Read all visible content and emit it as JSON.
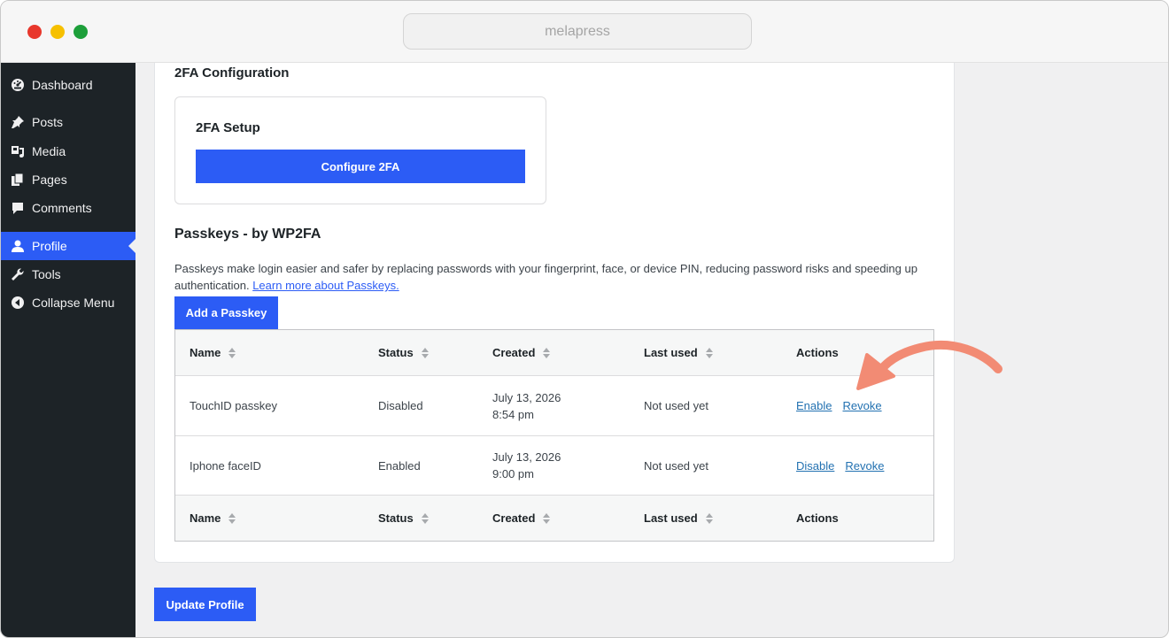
{
  "browser": {
    "url": "melapress"
  },
  "sidebar": {
    "items": [
      {
        "label": "Dashboard",
        "icon": "dashboard-icon"
      },
      {
        "label": "Posts",
        "icon": "pin-icon"
      },
      {
        "label": "Media",
        "icon": "media-icon"
      },
      {
        "label": "Pages",
        "icon": "pages-icon"
      },
      {
        "label": "Comments",
        "icon": "comment-icon"
      },
      {
        "label": "Profile",
        "icon": "user-icon",
        "active": true
      },
      {
        "label": "Tools",
        "icon": "wrench-icon"
      },
      {
        "label": "Collapse Menu",
        "icon": "collapse-icon"
      }
    ]
  },
  "twofa": {
    "heading": "2FA Configuration",
    "setup_title": "2FA Setup",
    "configure_label": "Configure 2FA"
  },
  "passkeys": {
    "heading": "Passkeys - by WP2FA",
    "description": "Passkeys make login easier and safer by replacing passwords with your fingerprint, face, or device PIN, reducing password risks and speeding up authentication.",
    "learn_more": "Learn more about Passkeys.",
    "add_label": "Add a Passkey",
    "columns": [
      "Name",
      "Status",
      "Created",
      "Last used",
      "Actions"
    ],
    "rows": [
      {
        "name": "TouchID passkey",
        "status": "Disabled",
        "created_date": "July 13, 2026",
        "created_time": "8:54 pm",
        "last_used": "Not used yet",
        "action1": "Enable",
        "action2": "Revoke"
      },
      {
        "name": "Iphone faceID",
        "status": "Enabled",
        "created_date": "July 13, 2026",
        "created_time": "9:00 pm",
        "last_used": "Not used yet",
        "action1": "Disable",
        "action2": "Revoke"
      }
    ]
  },
  "update_label": "Update Profile",
  "colors": {
    "accent": "#2c5cf5",
    "sidebar_bg": "#1d2327",
    "link": "#2271b1",
    "annotation_arrow": "#f28b74"
  }
}
